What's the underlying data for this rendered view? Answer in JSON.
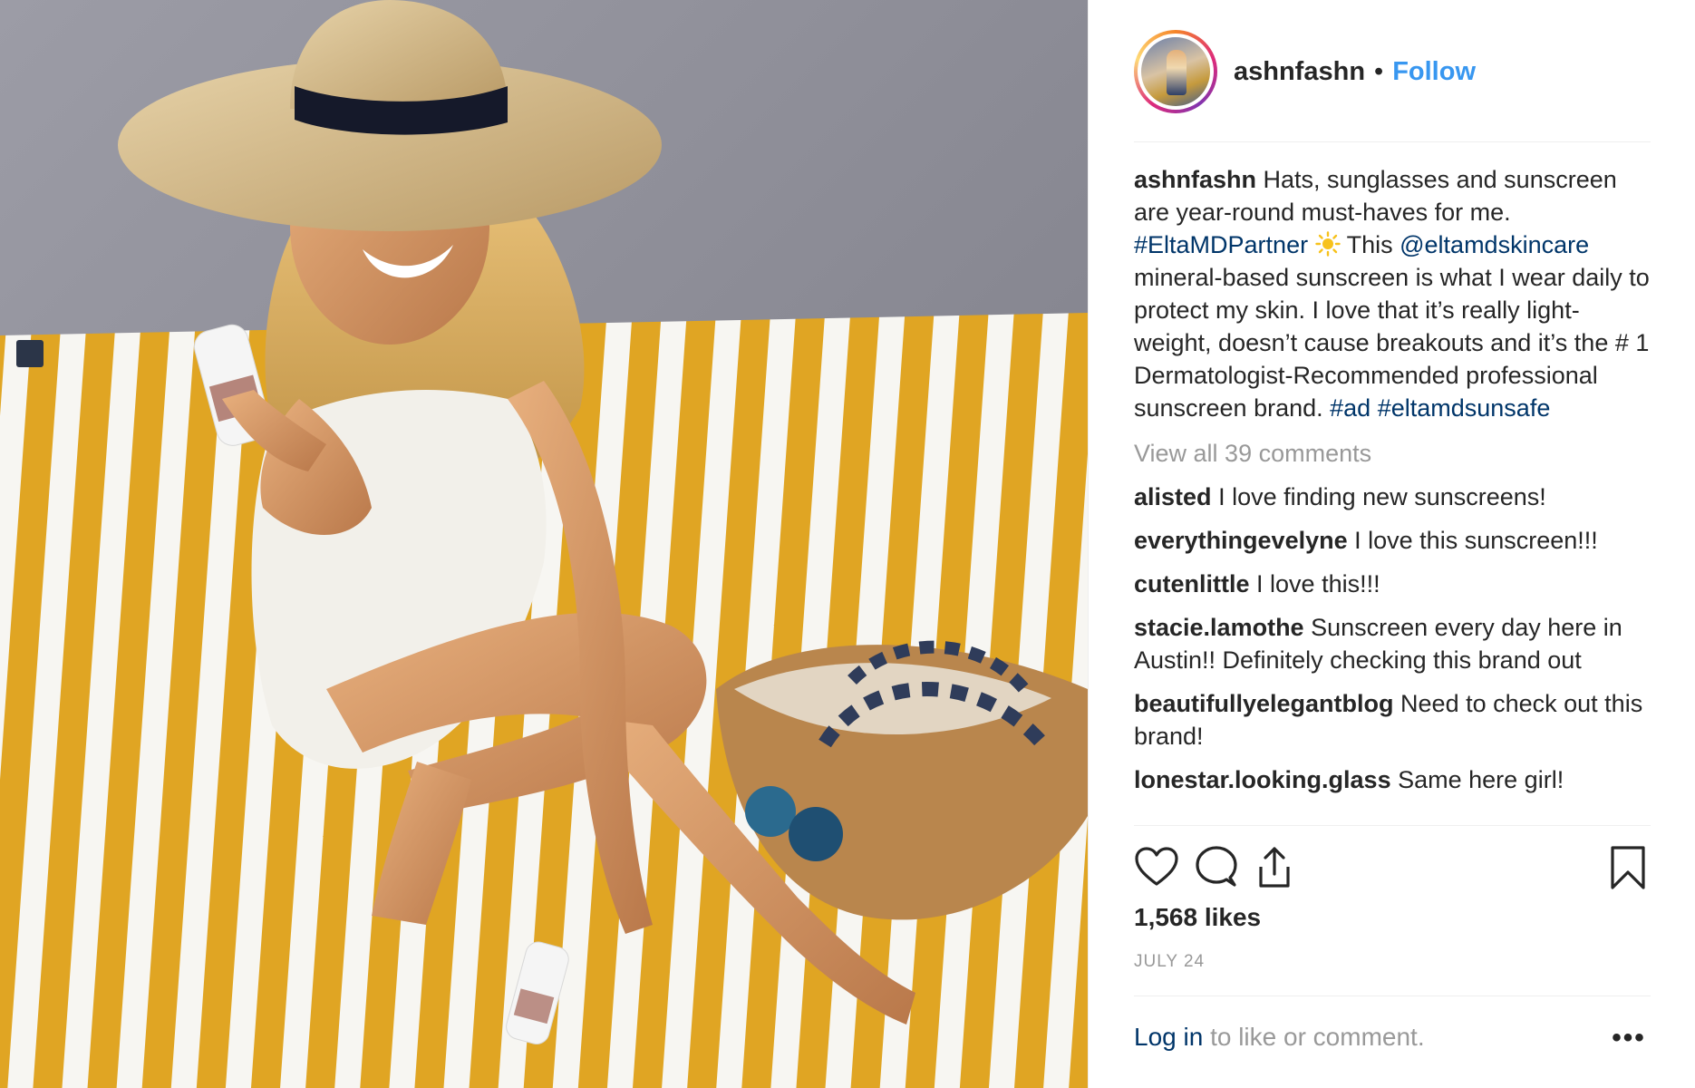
{
  "post": {
    "username": "ashnfashn",
    "dot": "•",
    "follow_label": "Follow",
    "caption": {
      "username": "ashnfashn",
      "text_1": " Hats, sunglasses and sunscreen are year-round must-haves for me. ",
      "hashtag_1": "#EltaMDPartner",
      "text_2": " This ",
      "mention": "@eltamdskincare",
      "text_3": " mineral-based sunscreen is what I wear daily to protect my skin. I love that it’s really light-weight, doesn’t cause breakouts and it’s the # 1 Dermatologist-Recommended professional sunscreen brand. ",
      "hashtag_2": "#ad",
      "hashtag_3": "#eltamdsunsafe"
    },
    "view_all_comments": "View all 39 comments",
    "comments": [
      {
        "user": "alisted",
        "text": "I love finding new sunscreens!"
      },
      {
        "user": "everythingevelyne",
        "text": "I love this sunscreen!!!"
      },
      {
        "user": "cutenlittle",
        "text": "I love this!!!"
      },
      {
        "user": "stacie.lamothe",
        "text": "Sunscreen every day here in Austin!! Definitely checking this brand out"
      },
      {
        "user": "beautifullyelegantblog",
        "text": "Need to check out this brand!"
      },
      {
        "user": "lonestar.looking.glass",
        "text": "Same here girl!"
      }
    ],
    "likes": "1,568 likes",
    "date": "JULY 24",
    "login_link": "Log in",
    "login_rest": " to like or comment.",
    "more_label": "•••",
    "icons": {
      "like": "heart-icon",
      "comment": "comment-icon",
      "share": "share-icon",
      "save": "bookmark-icon"
    },
    "colors": {
      "follow": "#3897f0",
      "link": "#003569",
      "muted": "#999999",
      "text": "#262626",
      "stripe_yellow": "#e0a523"
    }
  }
}
